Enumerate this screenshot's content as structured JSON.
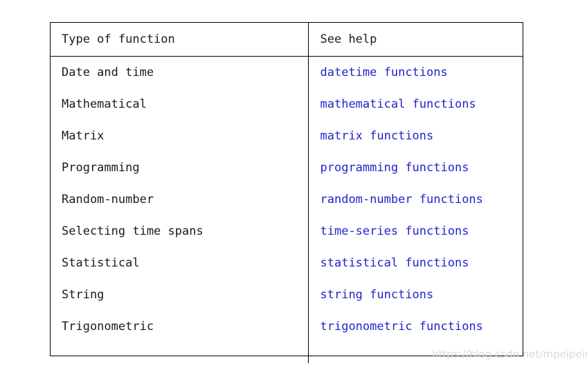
{
  "table": {
    "headers": [
      "Type of function",
      "See help"
    ],
    "rows": [
      {
        "type": "Date and time",
        "help": "datetime functions"
      },
      {
        "type": "Mathematical",
        "help": "mathematical functions"
      },
      {
        "type": "Matrix",
        "help": "matrix functions"
      },
      {
        "type": "Programming",
        "help": "programming functions"
      },
      {
        "type": "Random-number",
        "help": "random-number functions"
      },
      {
        "type": "Selecting time spans",
        "help": "time-series functions"
      },
      {
        "type": "Statistical",
        "help": "statistical functions"
      },
      {
        "type": "String",
        "help": "string functions"
      },
      {
        "type": "Trigonometric",
        "help": "trigonometric functions"
      }
    ]
  },
  "watermark": {
    "text": "https://blog.csdn.net/mpeipeisu"
  },
  "colors": {
    "text": "#1a1a1a",
    "link": "#2222cc",
    "border": "#000000",
    "background": "#ffffff",
    "watermark": "#d9d9d9"
  }
}
